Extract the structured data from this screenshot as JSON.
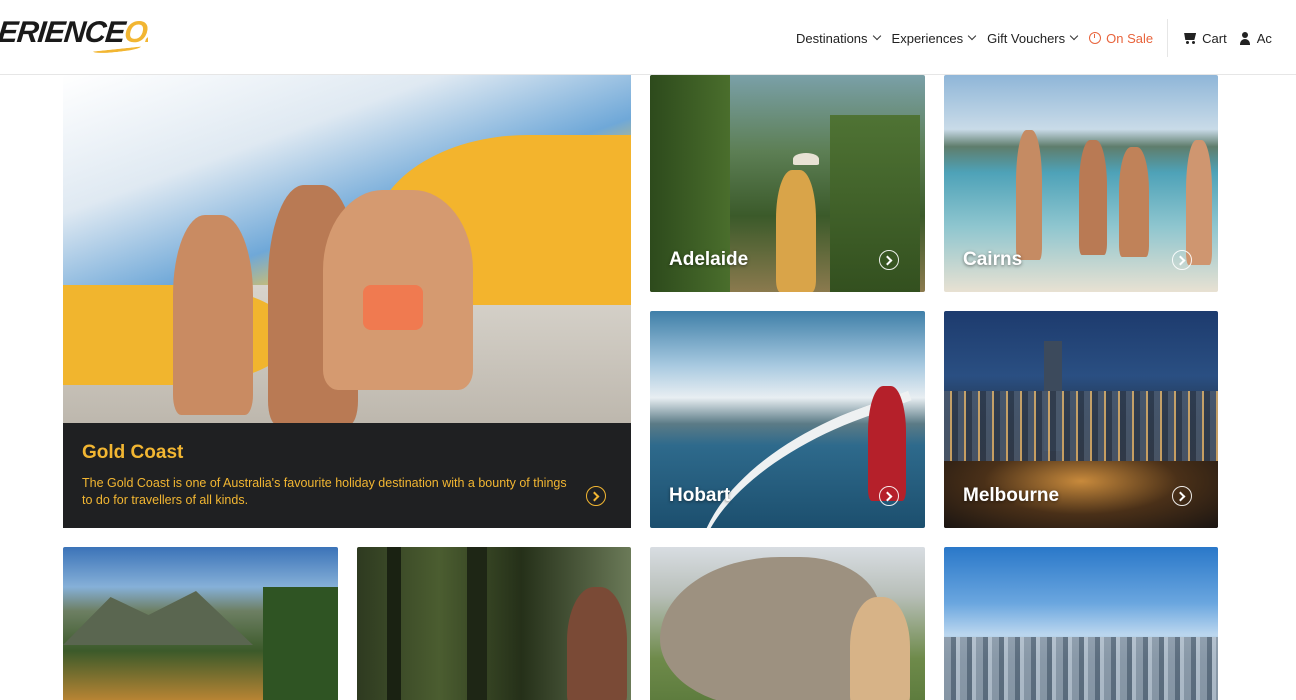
{
  "header": {
    "logo_main": "ERIENCE",
    "logo_accent": "OZ",
    "nav": {
      "destinations": "Destinations",
      "experiences": "Experiences",
      "gift_vouchers": "Gift Vouchers",
      "on_sale": "On Sale",
      "cart": "Cart",
      "account": "Ac"
    }
  },
  "colors": {
    "accent": "#f2b632",
    "sale": "#e8643c",
    "caption_bg": "#1f2022"
  },
  "feature": {
    "title": "Gold Coast",
    "description": "The Gold Coast is one of Australia's favourite holiday destination with a bounty of things to do for travellers of all kinds."
  },
  "destinations": [
    {
      "label": "Adelaide"
    },
    {
      "label": "Cairns"
    },
    {
      "label": "Hobart"
    },
    {
      "label": "Melbourne"
    }
  ]
}
